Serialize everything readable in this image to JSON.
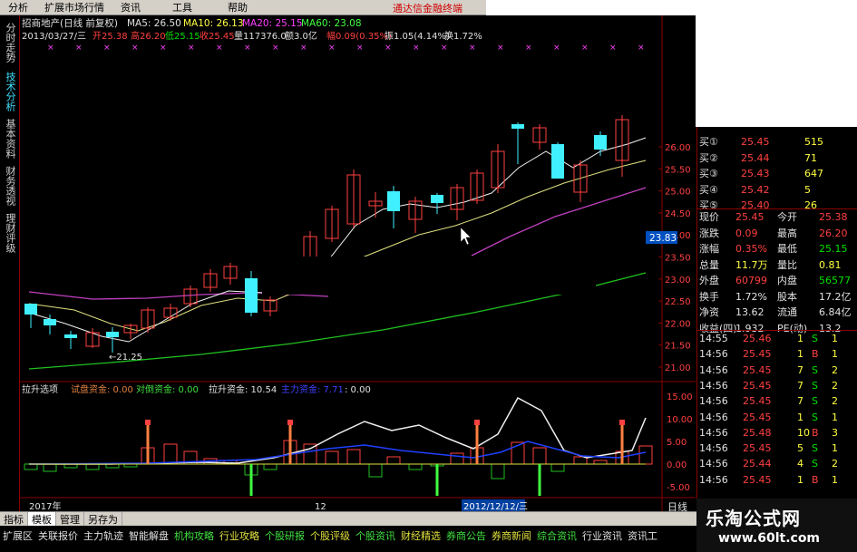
{
  "menubar": {
    "items": [
      "分析",
      "扩展市场行情",
      "资讯",
      "工具",
      "帮助"
    ],
    "promo": "通达信金融终端"
  },
  "left_tabs": [
    "分时走势",
    "技术分析",
    "基本资料",
    "财务透视",
    "理财评级"
  ],
  "chart_header": {
    "line1": {
      "name": "招商地产(日线 前复权)",
      "ma5": "MA5: 26.50",
      "ma10": "MA10: 26.13",
      "ma20": "MA20: 25.15",
      "ma60": "MA60: 23.08"
    },
    "line2": {
      "date": "2013/03/27/三",
      "open": "开25.38",
      "high": "高26.20",
      "low": "低25.15",
      "close": "收25.45",
      "vol": "量117376.0",
      "amount": "额3.0亿",
      "change": "幅0.09(0.35%)",
      "amp": "振1.05(4.14%)",
      "turnover": "换1.72%"
    }
  },
  "price_axis": [
    "26.00",
    "25.50",
    "25.00",
    "24.50",
    "24.00",
    "23.50",
    "23.00",
    "22.50",
    "22.00",
    "21.50",
    "21.00"
  ],
  "price_tag": "23.83",
  "low_label": "←21.25",
  "indicator_header": {
    "name": "拉升选项",
    "a": "试盘资金: 0.00",
    "b": "对倒资金: 0.00",
    "c": "拉升资金: 10.54",
    "d": "主力资金: 7.71",
    "e": ": 0.00"
  },
  "ind_axis": [
    "15.00",
    "10.00",
    "5.00",
    "0.00",
    "-5.00"
  ],
  "date_labels": {
    "left": "2017年",
    "mid": "12",
    "selected": "2012/12/12/三"
  },
  "quote": {
    "bids": [
      {
        "label": "买①",
        "price": "25.45",
        "vol": "515"
      },
      {
        "label": "买②",
        "price": "25.44",
        "vol": "71"
      },
      {
        "label": "买③",
        "price": "25.43",
        "vol": "647"
      },
      {
        "label": "买④",
        "price": "25.42",
        "vol": "5"
      },
      {
        "label": "买⑤",
        "price": "25.40",
        "vol": "26"
      }
    ],
    "stats": [
      [
        "现价",
        "25.45",
        "今开",
        "25.38"
      ],
      [
        "涨跌",
        "0.09",
        "最高",
        "26.20"
      ],
      [
        "涨幅",
        "0.35%",
        "最低",
        "25.15"
      ],
      [
        "总量",
        "11.7万",
        "量比",
        "0.81"
      ],
      [
        "外盘",
        "60799",
        "内盘",
        "56577"
      ],
      [
        "换手",
        "1.72%",
        "股本",
        "17.2亿"
      ],
      [
        "净资",
        "13.62",
        "流通",
        "6.84亿"
      ],
      [
        "收益(四)",
        "1.932",
        "PE(动)",
        "13.2"
      ]
    ],
    "ticks": [
      [
        "14:55",
        "25.46",
        "1",
        "S",
        "1"
      ],
      [
        "14:56",
        "25.45",
        "1",
        "B",
        "1"
      ],
      [
        "14:56",
        "25.45",
        "7",
        "S",
        "2"
      ],
      [
        "14:56",
        "25.45",
        "7",
        "S",
        "2"
      ],
      [
        "14:56",
        "25.45",
        "7",
        "S",
        "2"
      ],
      [
        "14:56",
        "25.45",
        "1",
        "S",
        "1"
      ],
      [
        "14:56",
        "25.48",
        "10",
        "B",
        "3"
      ],
      [
        "14:56",
        "25.45",
        "5",
        "S",
        "1"
      ],
      [
        "14:56",
        "25.44",
        "4",
        "S",
        "2"
      ],
      [
        "14:56",
        "25.45",
        "1",
        "B",
        "1"
      ]
    ]
  },
  "bottom_tabs": [
    "指标",
    "模板",
    "管理",
    "另存为"
  ],
  "navbar": [
    "扩展区",
    "关联报价",
    "主力轨迹",
    "智能解盘",
    "机构攻略",
    "行业攻略",
    "个股研报",
    "个股评级",
    "个股资讯",
    "财经精选",
    "券商公告",
    "券商新闻",
    "综合资讯",
    "行业资讯",
    "资讯工"
  ],
  "row_label": "日线",
  "watermark": {
    "title": "乐淘公式网",
    "url": "www.60lt.com"
  }
}
